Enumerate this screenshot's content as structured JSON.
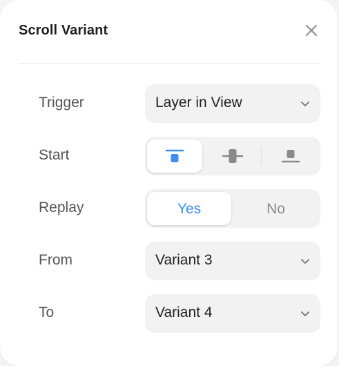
{
  "panel": {
    "title": "Scroll Variant",
    "close_icon": "close-icon"
  },
  "rows": {
    "trigger": {
      "label": "Trigger",
      "value": "Layer in View"
    },
    "start": {
      "label": "Start",
      "options": [
        {
          "icon": "align-top-icon",
          "selected": true
        },
        {
          "icon": "align-middle-icon",
          "selected": false
        },
        {
          "icon": "align-bottom-icon",
          "selected": false
        }
      ]
    },
    "replay": {
      "label": "Replay",
      "options": [
        {
          "label": "Yes",
          "selected": true
        },
        {
          "label": "No",
          "selected": false
        }
      ]
    },
    "from": {
      "label": "From",
      "value": "Variant 3"
    },
    "to": {
      "label": "To",
      "value": "Variant 4"
    }
  },
  "colors": {
    "accent": "#3b8ff0",
    "icon_active": "#3b8ff0",
    "icon_inactive": "#8a8a8a",
    "control_bg": "#f2f2f3"
  }
}
